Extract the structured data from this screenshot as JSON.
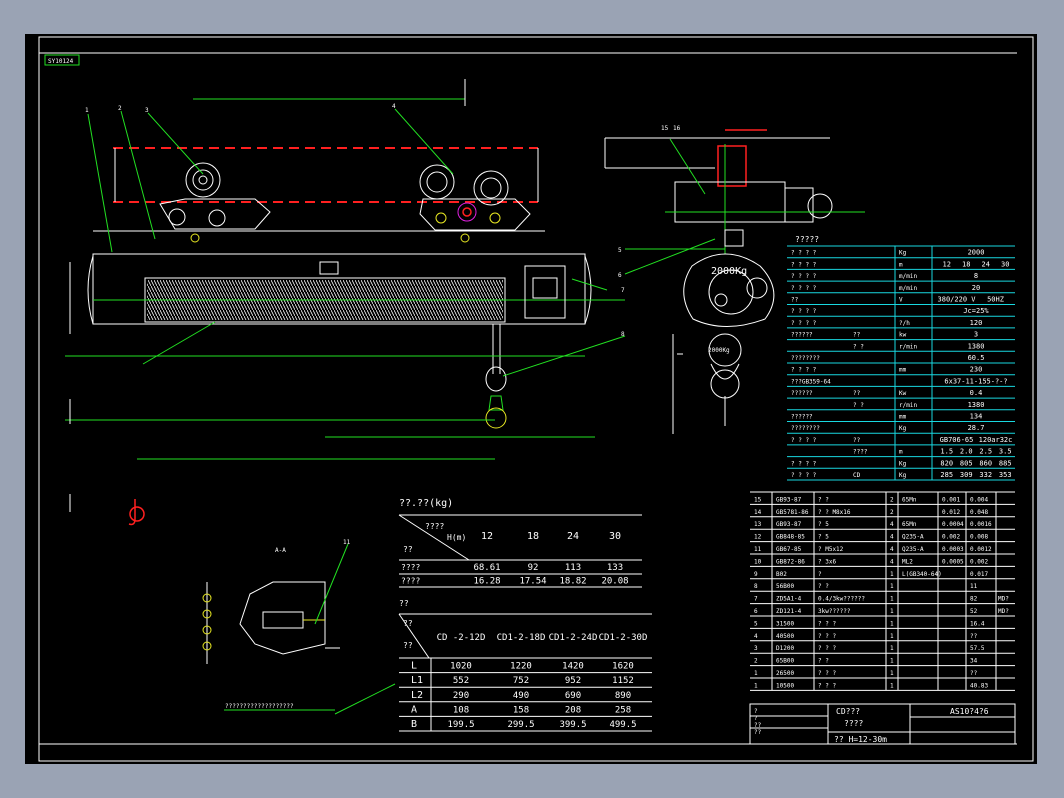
{
  "drawing_id": "SY10124",
  "balloons": [
    "1",
    "2",
    "3",
    "4",
    "5",
    "6",
    "7",
    "8",
    "11",
    "15",
    "16"
  ],
  "weight_label": "2000Kg",
  "spec_table": {
    "title": "?????",
    "rows": [
      {
        "name": "? ? ? ?",
        "sub": "",
        "unit": "Kg",
        "values": [
          "2000"
        ]
      },
      {
        "name": "? ? ? ?",
        "sub": "",
        "unit": "m",
        "values": [
          "12",
          "18",
          "24",
          "30"
        ]
      },
      {
        "name": "? ? ? ?",
        "sub": "",
        "unit": "m/min",
        "values": [
          "8"
        ]
      },
      {
        "name": "? ? ? ?",
        "sub": "",
        "unit": "m/min",
        "values": [
          "20"
        ]
      },
      {
        "name": "??",
        "sub": "",
        "unit": "V",
        "values": [
          "380/220 V",
          "50HZ"
        ]
      },
      {
        "name": "? ? ? ?",
        "sub": "",
        "unit": "",
        "values": [
          "Jc=25%"
        ]
      },
      {
        "name": "? ? ? ?",
        "sub": "",
        "unit": "?/h",
        "values": [
          "120"
        ]
      },
      {
        "name": "??????",
        "sub": "??",
        "unit": "kw",
        "values": [
          "3"
        ]
      },
      {
        "name": "",
        "sub": "? ?",
        "unit": "r/min",
        "values": [
          "1380"
        ]
      },
      {
        "name": "????????",
        "sub": "",
        "unit": "",
        "values": [
          "60.5"
        ]
      },
      {
        "name": "? ? ? ?",
        "sub": "",
        "unit": "mm",
        "values": [
          "230"
        ]
      },
      {
        "name": "???GB359-64",
        "sub": "",
        "unit": "",
        "values": [
          "6x37-11-155-?-?"
        ]
      },
      {
        "name": "??????",
        "sub": "??",
        "unit": "Kw",
        "values": [
          "0.4"
        ]
      },
      {
        "name": "",
        "sub": "? ?",
        "unit": "r/min",
        "values": [
          "1380"
        ]
      },
      {
        "name": "??????",
        "sub": "",
        "unit": "mm",
        "values": [
          "134"
        ]
      },
      {
        "name": "????????",
        "sub": "",
        "unit": "Kg",
        "values": [
          "28.7"
        ]
      },
      {
        "name": "? ? ? ?",
        "sub": "??",
        "unit": "",
        "values": [
          "GB706-65",
          "120ar32c"
        ]
      },
      {
        "name": "",
        "sub": "????",
        "unit": "m",
        "values": [
          "1.5",
          "2.0",
          "2.5",
          "3.5"
        ]
      },
      {
        "name": "? ? ? ?",
        "sub": "",
        "unit": "Kg",
        "values": [
          "820",
          "805",
          "860",
          "885"
        ]
      },
      {
        "name": "? ? ? ?",
        "sub": "CD",
        "unit": "Kg",
        "values": [
          "285",
          "309",
          "332",
          "353"
        ]
      }
    ]
  },
  "weight_table": {
    "title": "??.??(kg)",
    "corner_top": "????",
    "corner_axis": "H(m)",
    "corner_bottom": "??",
    "heights": [
      "12",
      "18",
      "24",
      "30"
    ],
    "rows": [
      {
        "label": "????",
        "values": [
          "68.61",
          "92",
          "113",
          "133"
        ]
      },
      {
        "label": "????",
        "values": [
          "16.28",
          "17.54",
          "18.82",
          "20.08"
        ]
      }
    ]
  },
  "dim_table": {
    "title": "??",
    "corner_top": "??",
    "corner_bottom": "??",
    "models": [
      "CD -2-12D",
      "CD1-2-18D",
      "CD1-2-24D",
      "CD1-2-30D"
    ],
    "rows": [
      {
        "label": "L",
        "values": [
          "1020",
          "1220",
          "1420",
          "1620"
        ]
      },
      {
        "label": "L1",
        "values": [
          "552",
          "752",
          "952",
          "1152"
        ]
      },
      {
        "label": "L2",
        "values": [
          "290",
          "490",
          "690",
          "890"
        ]
      },
      {
        "label": "A",
        "values": [
          "108",
          "158",
          "208",
          "258"
        ]
      },
      {
        "label": "B",
        "values": [
          "199.5",
          "299.5",
          "399.5",
          "499.5"
        ]
      }
    ]
  },
  "parts_list": [
    {
      "no": "15",
      "code": "GB93-87",
      "name": "? ?",
      "qty": "2",
      "mat": "65Mn",
      "w1": "0.001",
      "w2": "0.004"
    },
    {
      "no": "14",
      "code": "GB5781-86",
      "name": "? ? M8x16",
      "qty": "2",
      "mat": "",
      "w1": "0.012",
      "w2": "0.048"
    },
    {
      "no": "13",
      "code": "GB93-87",
      "name": "? 5",
      "qty": "4",
      "mat": "65Mn",
      "w1": "0.0004",
      "w2": "0.0016"
    },
    {
      "no": "12",
      "code": "GB848-85",
      "name": "? 5",
      "qty": "4",
      "mat": "Q235-A",
      "w1": "0.002",
      "w2": "0.008"
    },
    {
      "no": "11",
      "code": "GB67-85",
      "name": "? M5x12",
      "qty": "4",
      "mat": "Q235-A",
      "w1": "0.0003",
      "w2": "0.0012"
    },
    {
      "no": "10",
      "code": "GB872-86",
      "name": "? 3x6",
      "qty": "4",
      "mat": "ML2",
      "w1": "0.0005",
      "w2": "0.002"
    },
    {
      "no": "9",
      "code": "B02",
      "name": "?",
      "qty": "1",
      "mat": "L(GB340-64)",
      "w1": "",
      "w2": "0.017"
    },
    {
      "no": "8",
      "code": "56B00",
      "name": "? ?",
      "qty": "1",
      "mat": "",
      "w1": "",
      "w2": "11"
    },
    {
      "no": "7",
      "code": "ZD5A1-4",
      "name": "0.4/3kw??????",
      "qty": "1",
      "mat": "",
      "w1": "",
      "w2": "82",
      "extra": "MD?"
    },
    {
      "no": "6",
      "code": "ZD121-4",
      "name": "3kw??????",
      "qty": "1",
      "mat": "",
      "w1": "",
      "w2": "52",
      "extra": "MD?"
    },
    {
      "no": "5",
      "code": "31500",
      "name": "? ? ?",
      "qty": "1",
      "mat": "",
      "w1": "",
      "w2": "16.4"
    },
    {
      "no": "4",
      "code": "40500",
      "name": "? ? ?",
      "qty": "1",
      "mat": "",
      "w1": "",
      "w2": "??"
    },
    {
      "no": "3",
      "code": "D1200",
      "name": "? ? ?",
      "qty": "1",
      "mat": "",
      "w1": "",
      "w2": "57.5"
    },
    {
      "no": "2",
      "code": "65B00",
      "name": "? ?",
      "qty": "1",
      "mat": "",
      "w1": "",
      "w2": "34"
    },
    {
      "no": "1",
      "code": "26500",
      "name": "? ? ?",
      "qty": "1",
      "mat": "",
      "w1": "",
      "w2": "??"
    },
    {
      "no": "1",
      "code": "10500",
      "name": "? ? ?",
      "qty": "1",
      "mat": "",
      "w1": "",
      "w2": "40.83"
    }
  ],
  "title_block": {
    "product": "CD???",
    "sub": "????",
    "range": "??  H=12-30m",
    "code": "AS10?4?6",
    "cells": [
      "?",
      "?",
      "??",
      "??"
    ]
  },
  "section_label": "A-A",
  "note": "???????????????????",
  "colors": {
    "paper": "#000000",
    "frame": "#ffffff",
    "cyan": "#19d8e0",
    "green": "#22e022",
    "red": "#ff2020",
    "yellow": "#e8e822",
    "magenta": "#e020e0"
  }
}
